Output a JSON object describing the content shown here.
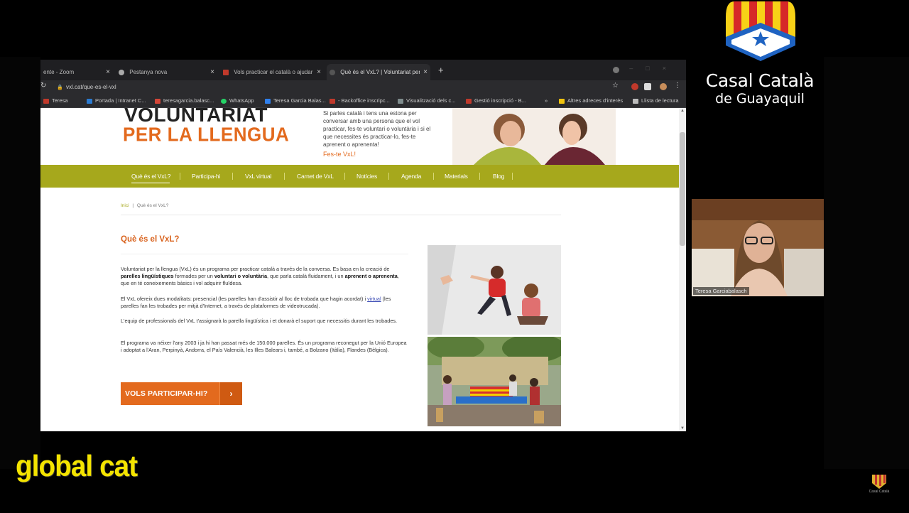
{
  "browser": {
    "tabs": [
      {
        "label": "ente - Zoom",
        "active": false
      },
      {
        "label": "Pestanya nova",
        "active": false
      },
      {
        "label": "Vols practicar el català o ajudar a",
        "active": false
      },
      {
        "label": "Què és el VxL? | Voluntariat per la",
        "active": true
      }
    ],
    "url": "vxl.cat/que-es-el-vxl",
    "bookmarks": [
      {
        "label": "Teresa",
        "color": "#c0392b"
      },
      {
        "label": "Portada | Intranet C...",
        "color": "#2b7bd1"
      },
      {
        "label": "teresagarcia.balasc...",
        "color": "#d44638"
      },
      {
        "label": "WhatsApp",
        "color": "#25d366"
      },
      {
        "label": "Teresa Garcia Balas...",
        "color": "#2f80ed"
      },
      {
        "label": "- Backoffice inscripc...",
        "color": "#c0392b"
      },
      {
        "label": "Visualització dels c...",
        "color": "#7f8c8d"
      },
      {
        "label": "Gestió inscripció - B...",
        "color": "#c0392b"
      },
      {
        "label": "»",
        "color": ""
      },
      {
        "label": "Altres adreces d'interès",
        "color": "#f1c40f"
      },
      {
        "label": "Llista de lectura",
        "color": "#bbb"
      }
    ]
  },
  "site": {
    "logo_line1": "VOLUNTARIAT",
    "logo_line2": "PER LA LLENGUA",
    "hero_text": "Si parles català i tens una estona per conversar amb una persona que el vol practicar, fes-te voluntari o voluntària i si el que necessites és practicar-lo, fes-te aprenent o aprenenta!",
    "hero_cta": "Fes-te VxL!",
    "nav": [
      "Què és el VxL?",
      "Participa-hi",
      "VxL virtual",
      "Carnet de VxL",
      "Notícies",
      "Agenda",
      "Materials",
      "Blog"
    ],
    "breadcrumb_home": "Inici",
    "breadcrumb_sep": "|",
    "breadcrumb_current": "Què és el VxL?",
    "title": "Què és el VxL?",
    "p1_a": "Voluntariat per la llengua (VxL) és un programa per practicar català a través de la conversa. Es basa en la creació de ",
    "p1_b": "parelles lingüístiques",
    "p1_c": " formades per un ",
    "p1_d": "voluntari o voluntària",
    "p1_e": ", que parla català fluidament, i un ",
    "p1_f": "aprenent o aprenenta",
    "p1_g": ", que en té coneixements bàsics i vol adquirir fluïdesa.",
    "p2_a": "El VxL ofereix dues modalitats: presencial (les parelles han d'assistir al lloc de trobada que hagin acordat) i ",
    "p2_link": "virtual",
    "p2_b": " (les parelles fan les trobades per mitjà d'Internet, a través de plataformes de videotrucada).",
    "p3": "L'equip de professionals del VxL t'assignarà la parella lingüística i et donarà el suport que necessitis durant les trobades.",
    "p4": "El programa va néixer l'any 2003 i ja hi han passat més de 150.000 parelles. És un programa reconegut per la Unió Europea i adoptat a l'Aran, Perpinyà, Andorra, el País Valencià, les Illes Balears i, també, a Bolzano (Itàlia), Flandes (Bèlgica).",
    "cta": "VOLS PARTICIPAR-HI?",
    "cta_arrow": "›"
  },
  "video": {
    "participant_name": "Teresa Garciabalasch"
  },
  "branding": {
    "casal_name": "Casal Català",
    "casal_sub": "de Guayaquil",
    "overlay": "global cat",
    "small_logo_text": "Casal Català de Guayaquil"
  },
  "colors": {
    "accent_orange": "#e36a1e",
    "nav_olive": "#a6a81c",
    "overlay_yellow": "#f4e400"
  }
}
